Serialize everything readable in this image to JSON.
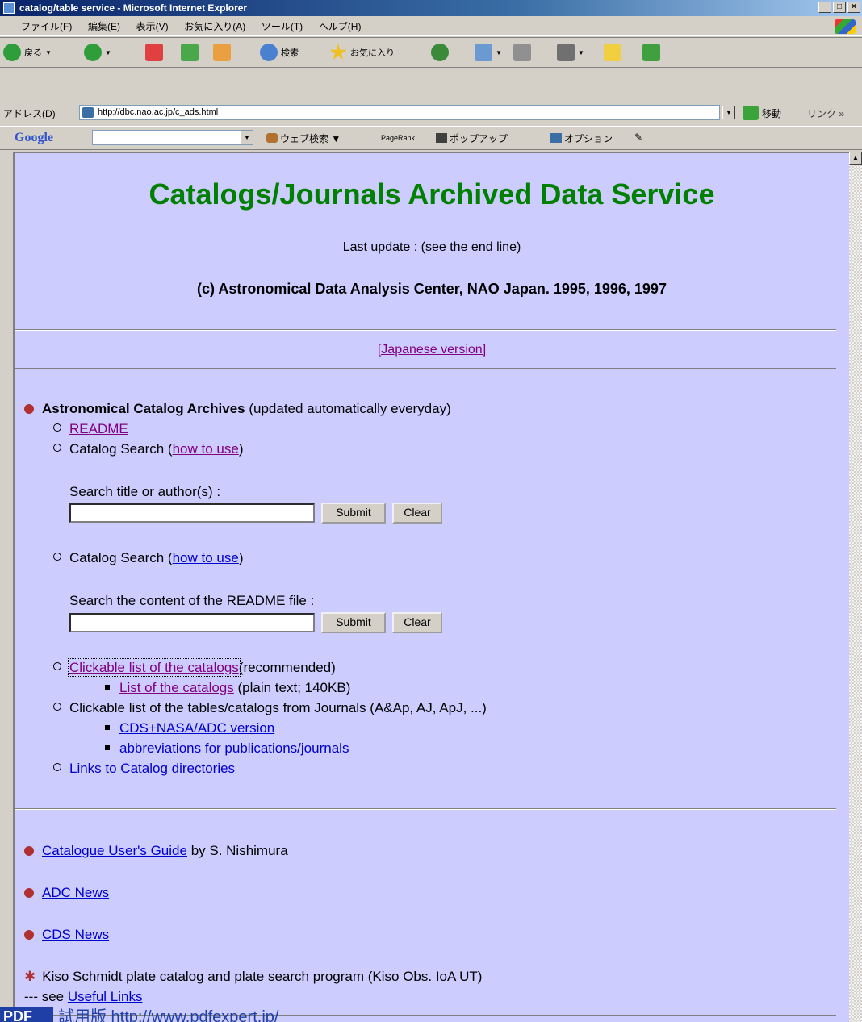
{
  "window": {
    "title": "catalog/table service - Microsoft Internet Explorer",
    "buttons": {
      "minimize": "_",
      "maximize": "□",
      "close": "×"
    }
  },
  "menubar": {
    "items": [
      "ファイル(F)",
      "編集(E)",
      "表示(V)",
      "お気に入り(A)",
      "ツール(T)",
      "ヘルプ(H)"
    ]
  },
  "toolbar": {
    "back": "戻る",
    "search": "検索",
    "favorites": "お気に入り"
  },
  "addressbar": {
    "label": "アドレス(D)",
    "url": "http://dbc.nao.ac.jp/c_ads.html",
    "go": "移動",
    "links": "リンク »"
  },
  "googlebar": {
    "logo": "Google",
    "web_search": "ウェブ検索",
    "pagerank": "PageRank",
    "popup": "ポップアップ",
    "options": "オプション"
  },
  "page": {
    "title": "Catalogs/Journals Archived Data Service",
    "last_update": "Last update : (see the end line)",
    "copyright": "(c) Astronomical Data Analysis Center, NAO Japan. 1995, 1996, 1997",
    "japanese_version": "[Japanese version]",
    "catalog_archives": {
      "heading": "Astronomical Catalog Archives",
      "heading_note": "(updated automatically everyday)",
      "readme": "README",
      "search1_label": "Catalog Search (",
      "search1_howto": "how to use",
      "search1_close": ")",
      "search1_prompt": "Search title or author(s) :",
      "search2_label": "Catalog Search (",
      "search2_howto": "how to use",
      "search2_close": ")",
      "search2_prompt": "Search the content of the README file :",
      "submit": "Submit",
      "clear": "Clear",
      "clickable_catalogs": "Clickable list of the catalogs",
      "clickable_catalogs_note": "(recommended)",
      "list_of_catalogs": "List of the catalogs",
      "list_of_catalogs_note": "(plain text; 140KB)",
      "clickable_tables": "Clickable list of the tables/catalogs from Journals (A&Ap, AJ, ApJ, ...)",
      "cds_nasa": "CDS+NASA/ADC version",
      "abbreviations": "abbreviations for publications/journals",
      "links_directories": "Links to Catalog directories"
    },
    "users_guide": "Catalogue User's Guide",
    "users_guide_by": "by S. Nishimura",
    "adc_news": "ADC News",
    "cds_news": "CDS News",
    "kiso_line": "Kiso Schmidt plate catalog and plate search program (Kiso Obs. IoA UT)",
    "see_prefix": "--- see",
    "useful_links": "Useful Links"
  },
  "watermark": {
    "badge": "PDF",
    "text": "試用版 http://www.pdfexpert.jp/"
  }
}
